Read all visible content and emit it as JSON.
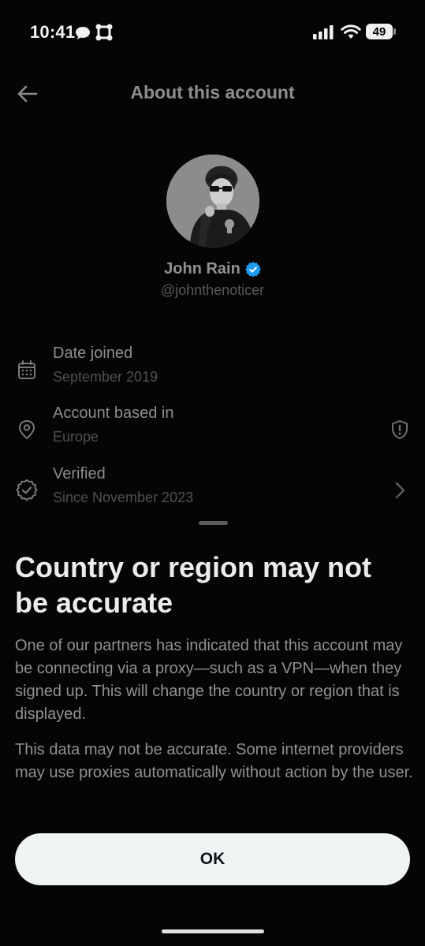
{
  "status_bar": {
    "time": "10:41",
    "battery": "49"
  },
  "header": {
    "title": "About this account"
  },
  "profile": {
    "name": "John Rain",
    "handle": "@johnthenoticer",
    "verified_badge_color": "#1d9bf0"
  },
  "info_rows": [
    {
      "label": "Date joined",
      "value": "September 2019",
      "icon": "calendar-icon"
    },
    {
      "label": "Account based in",
      "value": "Europe",
      "icon": "location-pin-icon",
      "trailing_icon": "shield-alert-icon"
    },
    {
      "label": "Verified",
      "value": "Since November 2023",
      "icon": "verified-badge-icon",
      "trailing_icon": "chevron-right-icon"
    }
  ],
  "sheet": {
    "title": "Country or region may not be accurate",
    "paragraph_1": "One of our partners has indicated that this account may be connecting via a proxy—such as a VPN—when they signed up. This will change the country or region that is displayed.",
    "paragraph_2": "This data may not be accurate. Some internet providers may use proxies automatically without action by the user.",
    "ok_label": "OK"
  },
  "colors": {
    "background": "#050505",
    "button_bg": "#eff3f4",
    "accent": "#1d9bf0"
  }
}
